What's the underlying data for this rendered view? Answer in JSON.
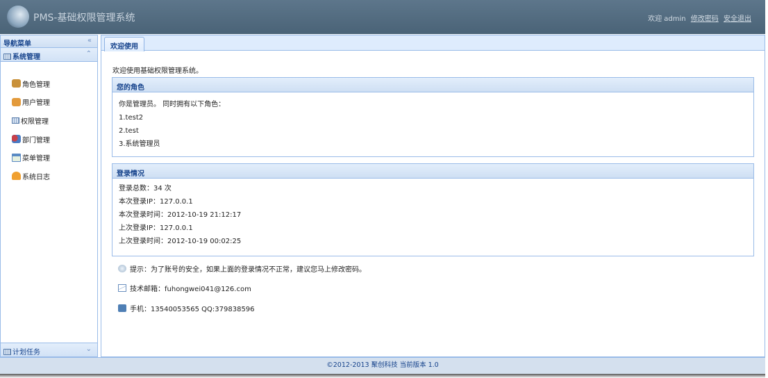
{
  "header": {
    "title": "PMS-基础权限管理系统",
    "welcome": "欢迎 admin",
    "change_password": "修改密码",
    "logout": "安全退出"
  },
  "sidebar": {
    "title": "导航菜单",
    "collapse_icon": "«",
    "group": {
      "label": "系统管理",
      "chevron": "⌃"
    },
    "items": [
      {
        "label": "角色管理",
        "color": "#c9913a"
      },
      {
        "label": "用户管理",
        "color": "#e39a3b"
      },
      {
        "label": "权限管理",
        "color": "#7c9ccc"
      },
      {
        "label": "部门管理",
        "color": "#c8414a"
      },
      {
        "label": "菜单管理",
        "color": "#5a8ac4"
      },
      {
        "label": "系统日志",
        "color": "#f0a030"
      }
    ],
    "bottom_group": {
      "label": "计划任务",
      "chevron": "⌄"
    }
  },
  "tab": {
    "label": "欢迎使用"
  },
  "main": {
    "welcome": "欢迎使用基础权限管理系统。",
    "roles": {
      "title": "您的角色",
      "intro": "你是管理员。 同时拥有以下角色：",
      "items": [
        "1.test2",
        "2.test",
        "3.系统管理员"
      ]
    },
    "login": {
      "title": "登录情况",
      "lines": [
        "登录总数：34 次",
        "本次登录IP：127.0.0.1",
        "本次登录时间：2012-10-19 21:12:17",
        "上次登录IP：127.0.0.1",
        "上次登录时间：2012-10-19 00:02:25"
      ]
    },
    "tip": "提示：为了账号的安全，如果上面的登录情况不正常，建议您马上修改密码。",
    "email": "技术邮箱：fuhongwei041@126.com",
    "phone": "手机：13540053565 QQ:379838596"
  },
  "footer": {
    "text": "©2012-2013 聚创科技  当前版本 1.0"
  }
}
